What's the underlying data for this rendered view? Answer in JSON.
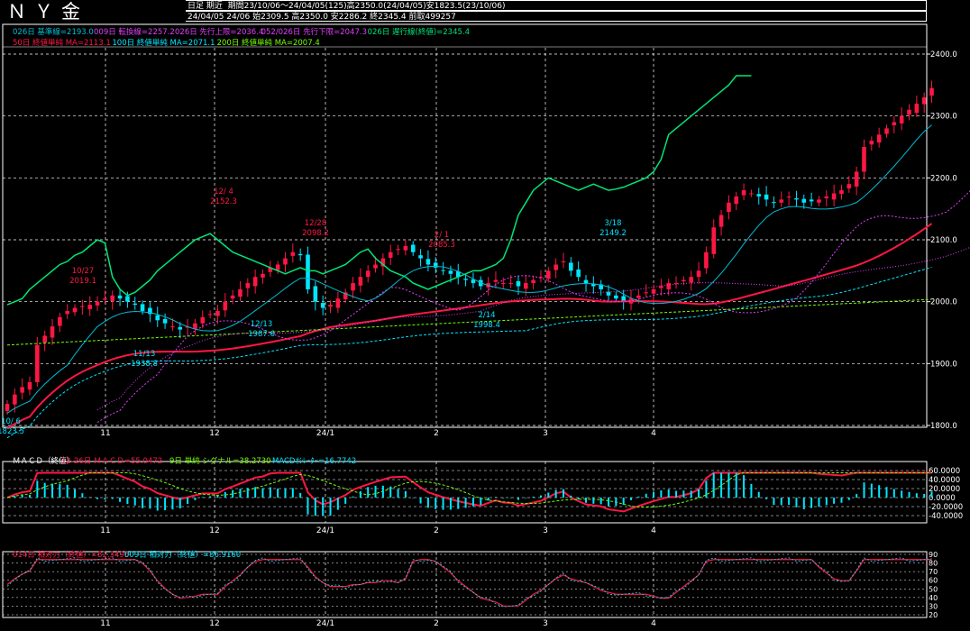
{
  "header": {
    "title": "ＮＹ金",
    "info1_a": "日足 期近",
    "info1_b": "期間23/10/06～24/04/05(125)高2350.0(24/04/05)安1823.5(23/10/06)",
    "info2": "24/04/05 24/06 始2309.5 高2350.0 安2286.2 終2345.4 前取499257"
  },
  "legend": {
    "line1": [
      {
        "text": "026日 基準線=2193.0",
        "color": "#00bcd4"
      },
      {
        "text": "009日 転換線=2257.2",
        "color": "#e040fb"
      },
      {
        "text": "026日 先行上限=2036.4",
        "color": "#e040fb"
      },
      {
        "text": "052/026日 先行下限=2047.3",
        "color": "#e040fb"
      },
      {
        "text": "026日 遅行線(終値)=2345.4",
        "color": "#00e676"
      }
    ],
    "line2": [
      {
        "text": "50日 終値単純 MA=2113.1",
        "color": "#ff1744"
      },
      {
        "text": "100日 終値単純 MA=2071.1",
        "color": "#00e5ff"
      },
      {
        "text": "200日 終値単純 MA=2007.4",
        "color": "#76ff03"
      }
    ]
  },
  "macd_legend": [
    {
      "text": "ＭＡＣＤ（終値）",
      "color": "#ffffff"
    },
    {
      "text": "12-26日 ＭＡＣＤ=55.0472",
      "color": "#ff1744"
    },
    {
      "text": "9日 単純 シグナル=38.2730",
      "color": "#76ff03"
    },
    {
      "text": "MACDｵｼﾚｰﾀｰ=16.7742",
      "color": "#00e5ff"
    }
  ],
  "rsi_legend": [
    {
      "text": "014日 相対力（終値）=82.3495",
      "color": "#ff1744"
    },
    {
      "text": "009日 相対力（終値）=86.9160",
      "color": "#00e5ff"
    }
  ],
  "x_ticks": [
    "11",
    "12",
    "24/1",
    "2",
    "3",
    "4"
  ],
  "annotations": [
    {
      "label": "10/27",
      "value": "2019.1",
      "color": "#ff1744"
    },
    {
      "label": "12/ 4",
      "value": "2152.3",
      "color": "#ff1744"
    },
    {
      "label": "12/28",
      "value": "2098.2",
      "color": "#ff1744"
    },
    {
      "label": "2/ 1",
      "value": "2085.3",
      "color": "#ff1744"
    },
    {
      "label": "11/13",
      "value": "1938.8",
      "color": "#00e5ff"
    },
    {
      "label": "12/13",
      "value": "1987.6",
      "color": "#00e5ff"
    },
    {
      "label": "2/14",
      "value": "1998.4",
      "color": "#00e5ff"
    },
    {
      "label": "3/18",
      "value": "2149.2",
      "color": "#00e5ff"
    },
    {
      "label": "10/ 6",
      "value": "1823.5",
      "color": "#00e5ff"
    }
  ],
  "colors": {
    "up": "#ff1744",
    "down": "#00e5ff",
    "grid": "#ffffff",
    "background": "#000000"
  },
  "chart_data": [
    {
      "type": "candlestick",
      "panel": "price",
      "ylim": [
        1800,
        2400
      ],
      "y_ticks": [
        "2400.0",
        "2300.0",
        "2200.0",
        "2100.0",
        "2000.0",
        "1900.0",
        "1800.0"
      ],
      "x_ticks": [
        "11",
        "12",
        "24/1",
        "2",
        "3",
        "4"
      ],
      "close": [
        1835,
        1850,
        1862,
        1870,
        1930,
        1945,
        1960,
        1975,
        1985,
        1990,
        1993,
        1995,
        2000,
        2005,
        2010,
        2005,
        2000,
        1995,
        1985,
        1980,
        1970,
        1965,
        1960,
        1955,
        1960,
        1965,
        1975,
        1980,
        1985,
        2000,
        2010,
        2020,
        2030,
        2040,
        2045,
        2055,
        2060,
        2070,
        2080,
        2075,
        2020,
        2000,
        1990,
        1995,
        2005,
        2015,
        2030,
        2040,
        2050,
        2060,
        2070,
        2080,
        2085,
        2090,
        2080,
        2070,
        2060,
        2055,
        2050,
        2045,
        2040,
        2035,
        2030,
        2025,
        2030,
        2035,
        2030,
        2030,
        2025,
        2030,
        2035,
        2040,
        2050,
        2060,
        2065,
        2050,
        2040,
        2030,
        2025,
        2020,
        2010,
        2005,
        2000,
        2005,
        2010,
        2015,
        2020,
        2025,
        2030,
        2030,
        2035,
        2040,
        2050,
        2080,
        2120,
        2140,
        2160,
        2170,
        2180,
        2175,
        2170,
        2165,
        2160,
        2165,
        2170,
        2165,
        2160,
        2162,
        2165,
        2170,
        2175,
        2180,
        2190,
        2210,
        2250,
        2260,
        2270,
        2280,
        2290,
        2300,
        2310,
        2320,
        2330,
        2345
      ],
      "ma": [
        {
          "name": "50日 終値単純 MA",
          "color": "#ff1744",
          "last": 2113.1
        },
        {
          "name": "100日 終値単純 MA",
          "color": "#00e5ff",
          "last": 2071.1
        },
        {
          "name": "200日 終値単純 MA",
          "color": "#76ff03",
          "last": 2007.4
        }
      ]
    },
    {
      "type": "line",
      "panel": "macd",
      "ylim": [
        -40,
        60
      ],
      "y_ticks": [
        "60.0000",
        "40.0000",
        "20.0000",
        "0.0000",
        "-20.0000",
        "-40.0000"
      ],
      "series": [
        {
          "name": "12-26日 ＭＡＣＤ",
          "color": "#ff1744",
          "last": 55.0472
        },
        {
          "name": "9日 単純 シグナル",
          "color": "#76ff03",
          "last": 38.273
        },
        {
          "name": "MACDｵｼﾚｰﾀｰ",
          "color": "#00e5ff",
          "last": 16.7742
        }
      ]
    },
    {
      "type": "line",
      "panel": "rsi",
      "ylim": [
        20,
        90
      ],
      "y_ticks": [
        "90",
        "80",
        "70",
        "60",
        "50",
        "40",
        "30",
        "20"
      ],
      "series": [
        {
          "name": "014日 相対力（終値）",
          "color": "#ff1744",
          "last": 82.3495
        },
        {
          "name": "009日 相対力（終値）",
          "color": "#00e5ff",
          "last": 86.916
        }
      ]
    }
  ]
}
